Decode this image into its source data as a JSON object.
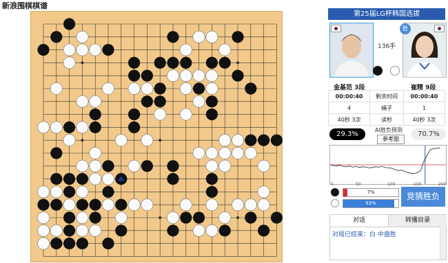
{
  "page": {
    "title": "新浪围棋棋谱"
  },
  "board": {
    "size": 19,
    "last_move": [
      6,
      12
    ],
    "black": [
      [
        2,
        0
      ],
      [
        1,
        1
      ],
      [
        3,
        1
      ],
      [
        10,
        1
      ],
      [
        12,
        1
      ],
      [
        15,
        1
      ],
      [
        11,
        2
      ],
      [
        14,
        2
      ],
      [
        4,
        2
      ],
      [
        5,
        2
      ],
      [
        0,
        2
      ],
      [
        7,
        3
      ],
      [
        10,
        3
      ],
      [
        11,
        3
      ],
      [
        13,
        3
      ],
      [
        14,
        3
      ],
      [
        9,
        3
      ],
      [
        8,
        4
      ],
      [
        7,
        4
      ],
      [
        15,
        4
      ],
      [
        16,
        5
      ],
      [
        9,
        5
      ],
      [
        11,
        5
      ],
      [
        12,
        5
      ],
      [
        8,
        6
      ],
      [
        9,
        6
      ],
      [
        13,
        6
      ],
      [
        4,
        7
      ],
      [
        7,
        7
      ],
      [
        13,
        7
      ],
      [
        4,
        8
      ],
      [
        1,
        8
      ],
      [
        2,
        8
      ],
      [
        3,
        8
      ],
      [
        7,
        8
      ],
      [
        16,
        9
      ],
      [
        17,
        9
      ],
      [
        14,
        9
      ],
      [
        18,
        9
      ],
      [
        1,
        10
      ],
      [
        5,
        11
      ],
      [
        10,
        11
      ],
      [
        8,
        11
      ],
      [
        4,
        12
      ],
      [
        3,
        12
      ],
      [
        1,
        12
      ],
      [
        2,
        12
      ],
      [
        0,
        13
      ],
      [
        6,
        12
      ],
      [
        10,
        12
      ],
      [
        13,
        12
      ],
      [
        13,
        13
      ],
      [
        2,
        13
      ],
      [
        5,
        13
      ],
      [
        1,
        14
      ],
      [
        0,
        14
      ],
      [
        3,
        14
      ],
      [
        4,
        14
      ],
      [
        6,
        14
      ],
      [
        12,
        15
      ],
      [
        11,
        15
      ],
      [
        16,
        15
      ],
      [
        18,
        15
      ],
      [
        2,
        16
      ],
      [
        6,
        16
      ],
      [
        14,
        16
      ],
      [
        10,
        16
      ],
      [
        17,
        16
      ],
      [
        2,
        17
      ],
      [
        5,
        17
      ],
      [
        3,
        17
      ],
      [
        1,
        16
      ],
      [
        1,
        17
      ],
      [
        4,
        15
      ],
      [
        2,
        15
      ]
    ],
    "white": [
      [
        3,
        1
      ],
      [
        2,
        2
      ],
      [
        3,
        2
      ],
      [
        12,
        1
      ],
      [
        13,
        1
      ],
      [
        11,
        2
      ],
      [
        14,
        2
      ],
      [
        4,
        2
      ],
      [
        2,
        3
      ],
      [
        11,
        4
      ],
      [
        12,
        4
      ],
      [
        13,
        4
      ],
      [
        10,
        4
      ],
      [
        11,
        5
      ],
      [
        13,
        5
      ],
      [
        1,
        5
      ],
      [
        5,
        5
      ],
      [
        7,
        5
      ],
      [
        8,
        5
      ],
      [
        12,
        6
      ],
      [
        9,
        7
      ],
      [
        11,
        7
      ],
      [
        4,
        6
      ],
      [
        3,
        6
      ],
      [
        2,
        9
      ],
      [
        1,
        8
      ],
      [
        0,
        8
      ],
      [
        3,
        8
      ],
      [
        6,
        9
      ],
      [
        8,
        9
      ],
      [
        14,
        9
      ],
      [
        15,
        9
      ],
      [
        14,
        10
      ],
      [
        15,
        10
      ],
      [
        16,
        10
      ],
      [
        4,
        10
      ],
      [
        12,
        10
      ],
      [
        13,
        10
      ],
      [
        14,
        11
      ],
      [
        17,
        11
      ],
      [
        13,
        11
      ],
      [
        3,
        11
      ],
      [
        4,
        11
      ],
      [
        7,
        11
      ],
      [
        5,
        12
      ],
      [
        4,
        12
      ],
      [
        5,
        14
      ],
      [
        1,
        13
      ],
      [
        0,
        13
      ],
      [
        3,
        13
      ],
      [
        17,
        13
      ],
      [
        13,
        14
      ],
      [
        15,
        14
      ],
      [
        16,
        14
      ],
      [
        17,
        14
      ],
      [
        2,
        14
      ],
      [
        6,
        15
      ],
      [
        7,
        14
      ],
      [
        8,
        14
      ],
      [
        11,
        14
      ],
      [
        0,
        15
      ],
      [
        14,
        15
      ],
      [
        3,
        15
      ],
      [
        0,
        16
      ],
      [
        1,
        16
      ],
      [
        4,
        16
      ],
      [
        12,
        16
      ],
      [
        13,
        16
      ],
      [
        0,
        17
      ],
      [
        3,
        16
      ],
      [
        10,
        15
      ]
    ]
  },
  "match": {
    "title": "第25届LG杯韩国选拔",
    "move_count": "136手",
    "win_badge": "胜"
  },
  "players": {
    "black_name": "金基范 3段",
    "white_name": "崔精 9段"
  },
  "stats": [
    {
      "left": "00:00:40",
      "label": "剩余时间",
      "right": "00:00:40"
    },
    {
      "left": "4",
      "label": "捕子",
      "right": "1"
    },
    {
      "left": "40秒 3次",
      "label": "读秒",
      "right": "40秒 3次"
    }
  ],
  "ai": {
    "black_pct": "29.3%",
    "white_pct": "70.7%",
    "label": "AI胜负预测",
    "ref_button": "参考图"
  },
  "winrate_graph": {
    "axis": [
      "0",
      "50",
      "100",
      "150",
      "200"
    ],
    "values": [
      0.5,
      0.48,
      0.47,
      0.49,
      0.46,
      0.45,
      0.47,
      0.44,
      0.46,
      0.43,
      0.45,
      0.44,
      0.42,
      0.43,
      0.45,
      0.44,
      0.46,
      0.43,
      0.42,
      0.41,
      0.38,
      0.35,
      0.36,
      0.33,
      0.3,
      0.28,
      0.27,
      0.3,
      0.35,
      0.6,
      0.75,
      0.9,
      0.92,
      0.93,
      0.94
    ]
  },
  "bars": {
    "black_pct": "7%",
    "black_value": 0.07,
    "white_pct": "93%",
    "white_value": 0.93,
    "guess_button": "竞猜胜负"
  },
  "tabs": [
    "对话",
    "转播目录"
  ],
  "chat": {
    "line": "对局已结束：白 中盘胜"
  },
  "colors": {
    "header": "#2a5bb0",
    "button": "#4a8ad8",
    "bar_black": "#d03030",
    "bar_white": "#3a7fd8"
  }
}
